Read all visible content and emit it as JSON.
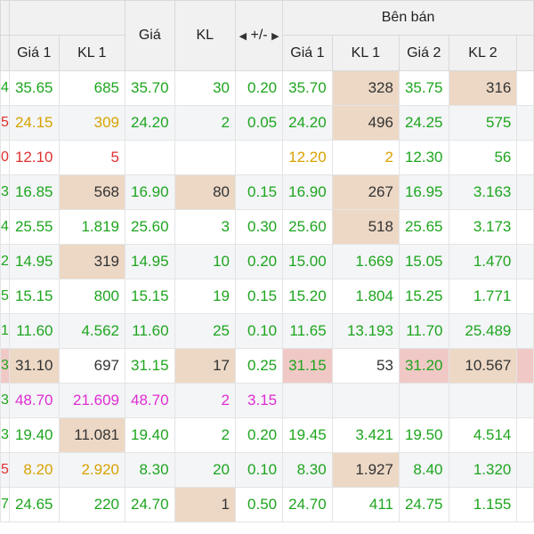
{
  "header": {
    "sell_title": "Bên bán",
    "col_buy_price1": "Giá 1",
    "col_buy_vol1": "KL 1",
    "col_match_price": "Giá",
    "col_match_vol": "KL",
    "col_change": "+/-",
    "col_sell_price1": "Giá 1",
    "col_sell_vol1": "KL 1",
    "col_sell_price2": "Giá 2",
    "col_sell_vol2": "KL 2"
  },
  "rows": [
    {
      "edge": "4",
      "buy_price1": "35.65",
      "buy_vol1": "685",
      "match_price": "35.70",
      "match_vol": "30",
      "change": "0.20",
      "sell_price1": "35.70",
      "sell_vol1": "328",
      "sell_price2": "35.75",
      "sell_vol2": "316"
    },
    {
      "edge": "5",
      "buy_price1": "24.15",
      "buy_vol1": "309",
      "match_price": "24.20",
      "match_vol": "2",
      "change": "0.05",
      "sell_price1": "24.20",
      "sell_vol1": "496",
      "sell_price2": "24.25",
      "sell_vol2": "575"
    },
    {
      "edge": "0",
      "buy_price1": "12.10",
      "buy_vol1": "5",
      "match_price": "",
      "match_vol": "",
      "change": "",
      "sell_price1": "12.20",
      "sell_vol1": "2",
      "sell_price2": "12.30",
      "sell_vol2": "56"
    },
    {
      "edge": "3",
      "buy_price1": "16.85",
      "buy_vol1": "568",
      "match_price": "16.90",
      "match_vol": "80",
      "change": "0.15",
      "sell_price1": "16.90",
      "sell_vol1": "267",
      "sell_price2": "16.95",
      "sell_vol2": "3.163"
    },
    {
      "edge": "4",
      "buy_price1": "25.55",
      "buy_vol1": "1.819",
      "match_price": "25.60",
      "match_vol": "3",
      "change": "0.30",
      "sell_price1": "25.60",
      "sell_vol1": "518",
      "sell_price2": "25.65",
      "sell_vol2": "3.173"
    },
    {
      "edge": "2",
      "buy_price1": "14.95",
      "buy_vol1": "319",
      "match_price": "14.95",
      "match_vol": "10",
      "change": "0.20",
      "sell_price1": "15.00",
      "sell_vol1": "1.669",
      "sell_price2": "15.05",
      "sell_vol2": "1.470"
    },
    {
      "edge": "5",
      "buy_price1": "15.15",
      "buy_vol1": "800",
      "match_price": "15.15",
      "match_vol": "19",
      "change": "0.15",
      "sell_price1": "15.20",
      "sell_vol1": "1.804",
      "sell_price2": "15.25",
      "sell_vol2": "1.771"
    },
    {
      "edge": "1",
      "buy_price1": "11.60",
      "buy_vol1": "4.562",
      "match_price": "11.60",
      "match_vol": "25",
      "change": "0.10",
      "sell_price1": "11.65",
      "sell_vol1": "13.193",
      "sell_price2": "11.70",
      "sell_vol2": "25.489"
    },
    {
      "edge": "3",
      "buy_price1": "31.10",
      "buy_vol1": "697",
      "match_price": "31.15",
      "match_vol": "17",
      "change": "0.25",
      "sell_price1": "31.15",
      "sell_vol1": "53",
      "sell_price2": "31.20",
      "sell_vol2": "10.567"
    },
    {
      "edge": "3",
      "buy_price1": "48.70",
      "buy_vol1": "21.609",
      "match_price": "48.70",
      "match_vol": "2",
      "change": "3.15",
      "sell_price1": "",
      "sell_vol1": "",
      "sell_price2": "",
      "sell_vol2": ""
    },
    {
      "edge": "3",
      "buy_price1": "19.40",
      "buy_vol1": "11.081",
      "match_price": "19.40",
      "match_vol": "2",
      "change": "0.20",
      "sell_price1": "19.45",
      "sell_vol1": "3.421",
      "sell_price2": "19.50",
      "sell_vol2": "4.514"
    },
    {
      "edge": "5",
      "buy_price1": "8.20",
      "buy_vol1": "2.920",
      "match_price": "8.30",
      "match_vol": "20",
      "change": "0.10",
      "sell_price1": "8.30",
      "sell_vol1": "1.927",
      "sell_price2": "8.40",
      "sell_vol2": "1.320"
    },
    {
      "edge": "7",
      "buy_price1": "24.65",
      "buy_vol1": "220",
      "match_price": "24.70",
      "match_vol": "1",
      "change": "0.50",
      "sell_price1": "24.70",
      "sell_vol1": "411",
      "sell_price2": "24.75",
      "sell_vol2": "1.155"
    }
  ],
  "colors": {
    "up": "#1ea51e",
    "reference": "#d8a200",
    "down": "#e03030",
    "ceiling": "#e02cd2",
    "highlight": "#ecd8c5",
    "highlight_red": "#f0c9c6"
  }
}
